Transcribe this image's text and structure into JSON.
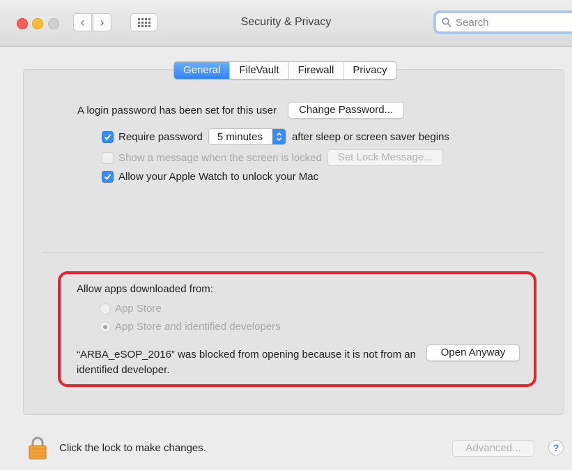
{
  "window": {
    "title": "Security & Privacy",
    "search_placeholder": "Search"
  },
  "tabs": [
    {
      "label": "General",
      "active": true
    },
    {
      "label": "FileVault",
      "active": false
    },
    {
      "label": "Firewall",
      "active": false
    },
    {
      "label": "Privacy",
      "active": false
    }
  ],
  "general": {
    "login_text": "A login password has been set for this user",
    "change_password_label": "Change Password...",
    "require_password": {
      "checked": true,
      "label": "Require password",
      "select_value": "5 minutes",
      "suffix": "after sleep or screen saver begins"
    },
    "show_message": {
      "checked": false,
      "enabled": false,
      "label": "Show a message when the screen is locked",
      "button_label": "Set Lock Message..."
    },
    "apple_watch": {
      "checked": true,
      "label": "Allow your Apple Watch to unlock your Mac"
    }
  },
  "gatekeeper": {
    "heading": "Allow apps downloaded from:",
    "options": [
      {
        "label": "App Store",
        "selected": false
      },
      {
        "label": "App Store and identified developers",
        "selected": true
      }
    ],
    "blocked_message": "“ARBA_eSOP_2016” was blocked from opening because it is not from an identified developer.",
    "open_anyway_label": "Open Anyway"
  },
  "footer": {
    "lock_text": "Click the lock to make changes.",
    "advanced_label": "Advanced...",
    "help_label": "?"
  },
  "colors": {
    "accent": "#3b8bf6",
    "highlight_border": "#e5262d",
    "lock_body": "#f0a33a"
  }
}
